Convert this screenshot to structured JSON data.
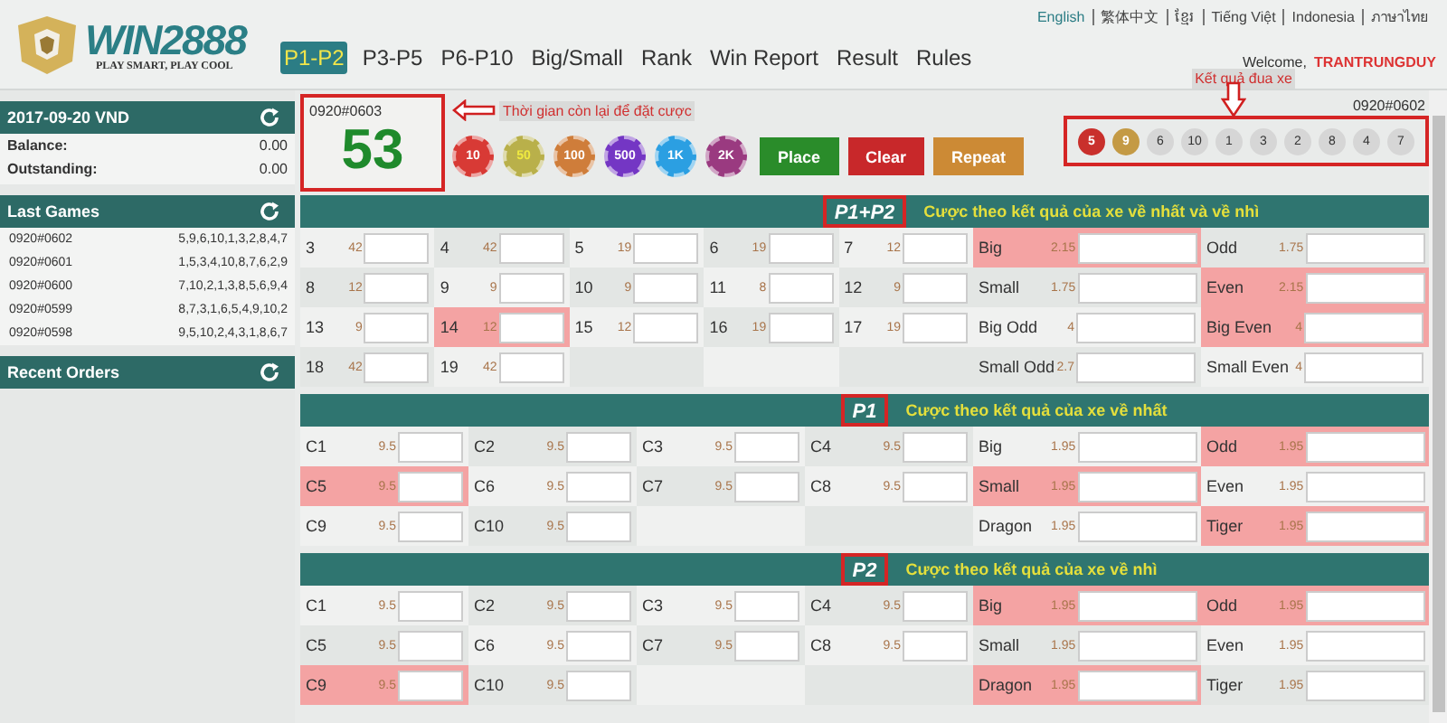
{
  "brand": {
    "name": "WIN2888",
    "slogan": "PLAY SMART, PLAY COOL"
  },
  "nav": [
    {
      "label": "P1-P2",
      "selected": true
    },
    {
      "label": "P3-P5",
      "selected": false
    },
    {
      "label": "P6-P10",
      "selected": false
    },
    {
      "label": "Big/Small",
      "selected": false
    },
    {
      "label": "Rank",
      "selected": false
    },
    {
      "label": "Win Report",
      "selected": false
    },
    {
      "label": "Result",
      "selected": false
    },
    {
      "label": "Rules",
      "selected": false
    }
  ],
  "languages": [
    {
      "label": "English",
      "selected": true
    },
    {
      "label": "繁体中文",
      "selected": false
    },
    {
      "label": "ខ្មែរ",
      "selected": false
    },
    {
      "label": "Tiếng Việt",
      "selected": false
    },
    {
      "label": "Indonesia",
      "selected": false
    },
    {
      "label": "ภาษาไทย",
      "selected": false
    }
  ],
  "welcome": {
    "label": "Welcome,",
    "user": "TRANTRUNGDUY"
  },
  "sidebar": {
    "account": {
      "title": "2017-09-20 VND",
      "rows": [
        {
          "label": "Balance:",
          "value": "0.00"
        },
        {
          "label": "Outstanding:",
          "value": "0.00"
        }
      ]
    },
    "last_games": {
      "title": "Last Games",
      "rows": [
        {
          "id": "0920#0602",
          "result": "5,9,6,10,1,3,2,8,4,7"
        },
        {
          "id": "0920#0601",
          "result": "1,5,3,4,10,8,7,6,2,9"
        },
        {
          "id": "0920#0600",
          "result": "7,10,2,1,3,8,5,6,9,4"
        },
        {
          "id": "0920#0599",
          "result": "8,7,3,1,6,5,4,9,10,2"
        },
        {
          "id": "0920#0598",
          "result": "9,5,10,2,4,3,1,8,6,7"
        }
      ]
    },
    "recent_orders": {
      "title": "Recent Orders"
    }
  },
  "countdown": {
    "id": "0920#0603",
    "seconds": "53",
    "boxed": true,
    "note": "Thời gian còn lại để đặt cược"
  },
  "chips": [
    {
      "label": "10",
      "color": "#d83a35"
    },
    {
      "label": "50",
      "color": "#b9b04a"
    },
    {
      "label": "100",
      "color": "#cf7d3a"
    },
    {
      "label": "500",
      "color": "#7436c4"
    },
    {
      "label": "1K",
      "color": "#2b9fe2"
    },
    {
      "label": "2K",
      "color": "#9a3a80"
    }
  ],
  "actions": [
    {
      "label": "Place",
      "kind": "place"
    },
    {
      "label": "Clear",
      "kind": "clear"
    },
    {
      "label": "Repeat",
      "kind": "repeat"
    }
  ],
  "last_result": {
    "note": "Kết quả đua xe",
    "id": "0920#0602",
    "boxed": true,
    "balls": [
      {
        "label": "5",
        "color": "#c9302c"
      },
      {
        "label": "9",
        "color": "#c49a45"
      },
      {
        "label": "6",
        "color": "#d6d6d6"
      },
      {
        "label": "10",
        "color": "#d6d6d6"
      },
      {
        "label": "1",
        "color": "#d6d6d6"
      },
      {
        "label": "3",
        "color": "#d6d6d6"
      },
      {
        "label": "2",
        "color": "#d6d6d6"
      },
      {
        "label": "8",
        "color": "#d6d6d6"
      },
      {
        "label": "4",
        "color": "#d6d6d6"
      },
      {
        "label": "7",
        "color": "#d6d6d6"
      }
    ]
  },
  "sections": [
    {
      "label": "P1+P2",
      "boxed": true,
      "caption": "Cược theo kết quả của xe về nhất và về nhì",
      "number_rows": [
        [
          {
            "label": "3",
            "odds": "42",
            "highlighted": false
          },
          {
            "label": "4",
            "odds": "42",
            "highlighted": false
          },
          {
            "label": "5",
            "odds": "19",
            "highlighted": false
          },
          {
            "label": "6",
            "odds": "19",
            "highlighted": false
          },
          {
            "label": "7",
            "odds": "12",
            "highlighted": false
          }
        ],
        [
          {
            "label": "8",
            "odds": "12",
            "highlighted": false
          },
          {
            "label": "9",
            "odds": "9",
            "highlighted": false
          },
          {
            "label": "10",
            "odds": "9",
            "highlighted": false
          },
          {
            "label": "11",
            "odds": "8",
            "highlighted": false
          },
          {
            "label": "12",
            "odds": "9",
            "highlighted": false
          }
        ],
        [
          {
            "label": "13",
            "odds": "9",
            "highlighted": false
          },
          {
            "label": "14",
            "odds": "12",
            "highlighted": true
          },
          {
            "label": "15",
            "odds": "12",
            "highlighted": false
          },
          {
            "label": "16",
            "odds": "19",
            "highlighted": false
          },
          {
            "label": "17",
            "odds": "19",
            "highlighted": false
          }
        ],
        [
          {
            "label": "18",
            "odds": "42",
            "highlighted": false
          },
          {
            "label": "19",
            "odds": "42",
            "highlighted": false
          }
        ]
      ],
      "side_rows": [
        [
          {
            "label": "Big",
            "odds": "2.15",
            "highlighted": true
          },
          {
            "label": "Odd",
            "odds": "1.75",
            "highlighted": false
          }
        ],
        [
          {
            "label": "Small",
            "odds": "1.75",
            "highlighted": false
          },
          {
            "label": "Even",
            "odds": "2.15",
            "highlighted": true
          }
        ],
        [
          {
            "label": "Big Odd",
            "odds": "4",
            "highlighted": false
          },
          {
            "label": "Big Even",
            "odds": "4",
            "highlighted": true
          }
        ],
        [
          {
            "label": "Small Odd",
            "odds": "2.7",
            "highlighted": false
          },
          {
            "label": "Small Even",
            "odds": "4",
            "highlighted": false
          }
        ]
      ]
    },
    {
      "label": "P1",
      "boxed": true,
      "caption": "Cược theo kết quả của xe về nhất",
      "number_rows": [
        [
          {
            "label": "C1",
            "odds": "9.5",
            "highlighted": false
          },
          {
            "label": "C2",
            "odds": "9.5",
            "highlighted": false
          },
          {
            "label": "C3",
            "odds": "9.5",
            "highlighted": false
          },
          {
            "label": "C4",
            "odds": "9.5",
            "highlighted": false
          }
        ],
        [
          {
            "label": "C5",
            "odds": "9.5",
            "highlighted": true
          },
          {
            "label": "C6",
            "odds": "9.5",
            "highlighted": false
          },
          {
            "label": "C7",
            "odds": "9.5",
            "highlighted": false
          },
          {
            "label": "C8",
            "odds": "9.5",
            "highlighted": false
          }
        ],
        [
          {
            "label": "C9",
            "odds": "9.5",
            "highlighted": false
          },
          {
            "label": "C10",
            "odds": "9.5",
            "highlighted": false
          }
        ]
      ],
      "side_rows": [
        [
          {
            "label": "Big",
            "odds": "1.95",
            "highlighted": false
          },
          {
            "label": "Odd",
            "odds": "1.95",
            "highlighted": true
          }
        ],
        [
          {
            "label": "Small",
            "odds": "1.95",
            "highlighted": true
          },
          {
            "label": "Even",
            "odds": "1.95",
            "highlighted": false
          }
        ],
        [
          {
            "label": "Dragon",
            "odds": "1.95",
            "highlighted": false
          },
          {
            "label": "Tiger",
            "odds": "1.95",
            "highlighted": true
          }
        ]
      ]
    },
    {
      "label": "P2",
      "boxed": true,
      "caption": "Cược theo kết quả của xe về nhì",
      "number_rows": [
        [
          {
            "label": "C1",
            "odds": "9.5",
            "highlighted": false
          },
          {
            "label": "C2",
            "odds": "9.5",
            "highlighted": false
          },
          {
            "label": "C3",
            "odds": "9.5",
            "highlighted": false
          },
          {
            "label": "C4",
            "odds": "9.5",
            "highlighted": false
          }
        ],
        [
          {
            "label": "C5",
            "odds": "9.5",
            "highlighted": false
          },
          {
            "label": "C6",
            "odds": "9.5",
            "highlighted": false
          },
          {
            "label": "C7",
            "odds": "9.5",
            "highlighted": false
          },
          {
            "label": "C8",
            "odds": "9.5",
            "highlighted": false
          }
        ],
        [
          {
            "label": "C9",
            "odds": "9.5",
            "highlighted": true
          },
          {
            "label": "C10",
            "odds": "9.5",
            "highlighted": false
          }
        ]
      ],
      "side_rows": [
        [
          {
            "label": "Big",
            "odds": "1.95",
            "highlighted": true
          },
          {
            "label": "Odd",
            "odds": "1.95",
            "highlighted": true
          }
        ],
        [
          {
            "label": "Small",
            "odds": "1.95",
            "highlighted": false
          },
          {
            "label": "Even",
            "odds": "1.95",
            "highlighted": false
          }
        ],
        [
          {
            "label": "Dragon",
            "odds": "1.95",
            "highlighted": true
          },
          {
            "label": "Tiger",
            "odds": "1.95",
            "highlighted": false
          }
        ]
      ]
    }
  ]
}
